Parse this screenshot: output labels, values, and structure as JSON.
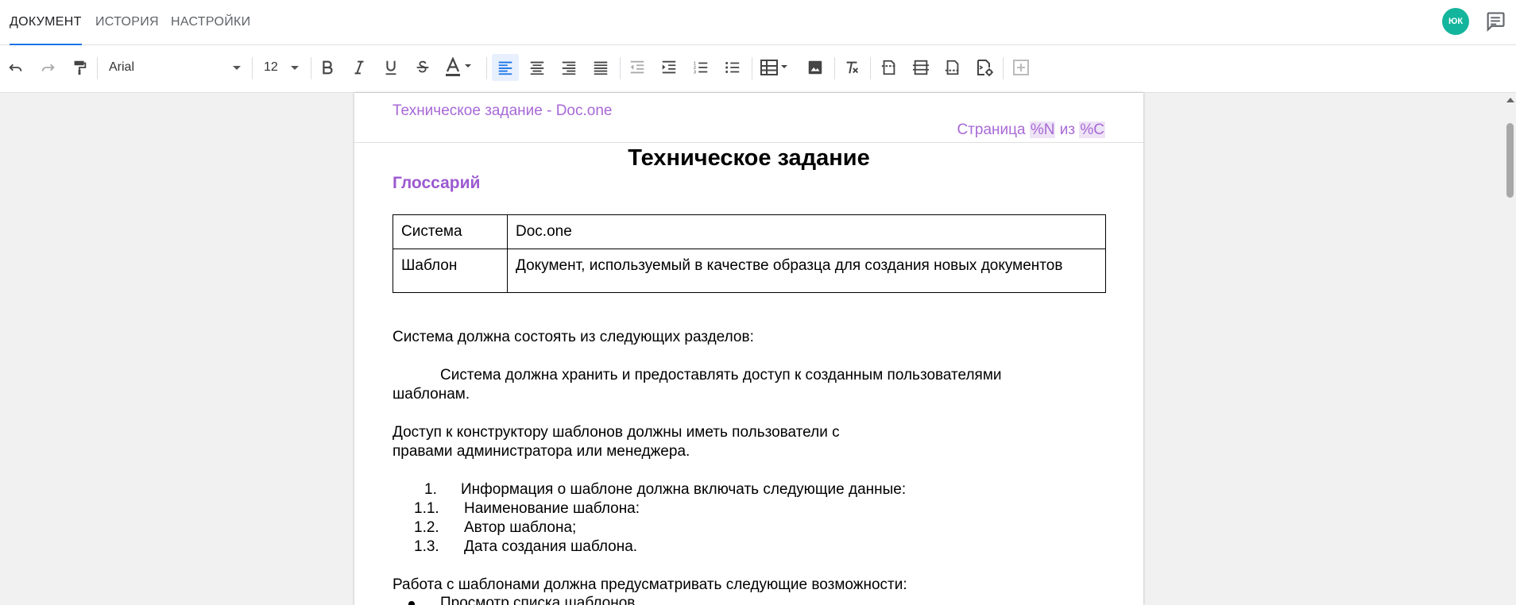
{
  "tabs": [
    {
      "label": "ДОКУМЕНТ",
      "active": true
    },
    {
      "label": "ИСТОРИЯ",
      "active": false
    },
    {
      "label": "НАСТРОЙКИ",
      "active": false
    }
  ],
  "user": {
    "initials": "ЮК",
    "avatar_color": "#13b59c"
  },
  "toolbar": {
    "font_family": "Arial",
    "font_size": "12",
    "buttons": [
      "undo-icon",
      "redo-icon",
      "paint-format-icon",
      "bold-icon",
      "italic-icon",
      "underline-icon",
      "strikethrough-icon",
      "text-color-icon",
      "align-left-icon",
      "align-center-icon",
      "align-right-icon",
      "align-justify-icon",
      "outdent-icon",
      "indent-icon",
      "numbered-list-icon",
      "bulleted-list-icon",
      "table-icon",
      "image-icon",
      "clear-formatting-icon",
      "page-header-icon",
      "section-icon",
      "page-footer-icon",
      "page-settings-icon",
      "add-comment-icon"
    ],
    "active_button": "align-left-icon",
    "accent": "#1a73e8"
  },
  "document": {
    "header_title": "Техническое задание - Doc.one",
    "header_page_prefix": "Страница",
    "header_page_field_n": "%N",
    "header_page_of": "из",
    "header_page_field_c": "%C",
    "header_color": "#a869d6",
    "title": "Техническое задание",
    "glossary_heading": "Глоссарий",
    "glossary": [
      {
        "term": "Система",
        "definition": "Doc.one"
      },
      {
        "term": "Шаблон",
        "definition": "Документ, используемый в качестве образца для создания новых документов"
      }
    ],
    "p1": "Система должна состоять из следующих разделов:",
    "p2_line1": "Система должна хранить и предоставлять доступ к созданным пользователями",
    "p2_line2": "шаблонам.",
    "p3_line1": "Доступ к конструктору шаблонов должны иметь пользователи с",
    "p3_line2": "правами администратора или менеджера.",
    "list_item_1": {
      "num": "1.",
      "text": "Информация о шаблоне должна включать следующие данные:"
    },
    "sub_items": [
      {
        "num": "1.1.",
        "text": "Наименование шаблона:"
      },
      {
        "num": "1.2.",
        "text": "Автор шаблона;"
      },
      {
        "num": "1.3.",
        "text": "Дата создания шаблона."
      }
    ],
    "p4": "Работа с шаблонами должна предусматривать следующие возможности:",
    "bullet_1": "Просмотр списка шаблонов"
  }
}
